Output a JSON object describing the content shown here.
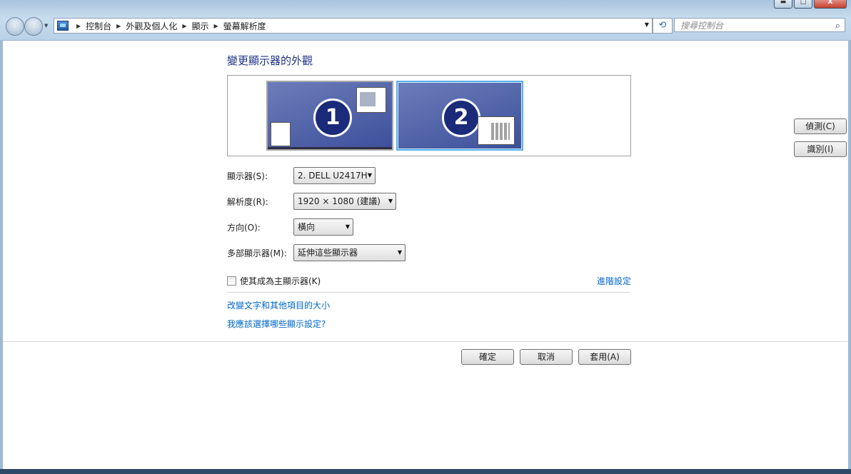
{
  "window": {
    "title_controls": [
      "▬",
      "□",
      "X"
    ]
  },
  "breadcrumb": {
    "items": [
      "控制台",
      "外觀及個人化",
      "顯示",
      "螢幕解析度"
    ]
  },
  "search": {
    "placeholder": "搜尋控制台"
  },
  "page": {
    "heading": "變更顯示器的外觀",
    "monitors": [
      {
        "number": "1",
        "selected": false
      },
      {
        "number": "2",
        "selected": true
      }
    ],
    "detect_label": "偵測(C)",
    "identify_label": "識別(I)",
    "fields": {
      "display_label": "顯示器(S):",
      "display_value": "2. DELL U2417H",
      "resolution_label": "解析度(R):",
      "resolution_value": "1920 × 1080 (建議)",
      "orientation_label": "方向(O):",
      "orientation_value": "橫向",
      "multi_label": "多部顯示器(M):",
      "multi_value": "延伸這些顯示器"
    },
    "main_display_checkbox": {
      "label": "使其成為主顯示器(K)",
      "checked": false
    },
    "advanced_link": "進階設定",
    "links": [
      "改變文字和其他項目的大小",
      "我應該選擇哪些顯示設定?"
    ],
    "ok_label": "確定",
    "cancel_label": "取消",
    "apply_label": "套用(A)"
  },
  "colors": {
    "link": "#0066cc",
    "heading": "#1e3287",
    "monitor_badge": "#1b2b7a"
  }
}
